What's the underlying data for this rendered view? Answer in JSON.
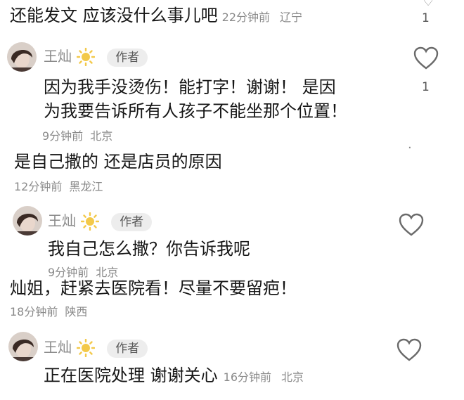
{
  "comments": [
    {
      "text": "还能发文 应该没什么事儿吧",
      "time": "22分钟前",
      "location": "辽宁",
      "likes": "1"
    },
    {
      "author": "王灿",
      "badge": "作者",
      "text_lines": [
        "因为我手没烫伤！能打字！谢谢！ 是因",
        "为我要告诉所有人孩子不能坐那个位置！"
      ],
      "time": "9分钟前",
      "location": "北京",
      "likes": "1"
    },
    {
      "text": "是自己撒的 还是店员的原因",
      "time": "12分钟前",
      "location": "黑龙江"
    },
    {
      "author": "王灿",
      "badge": "作者",
      "text": "我自己怎么撒？你告诉我呢",
      "time": "9分钟前",
      "location": "北京"
    },
    {
      "text": "灿姐，赶紧去医院看！尽量不要留疤！",
      "time": "18分钟前",
      "location": "陕西"
    },
    {
      "author": "王灿",
      "badge": "作者",
      "text": "正在医院处理 谢谢关心",
      "time": "16分钟前",
      "location": "北京"
    }
  ],
  "icons": {
    "like": "heart-outline-icon",
    "author_mark": "sun-icon",
    "avatar": "user-avatar"
  }
}
